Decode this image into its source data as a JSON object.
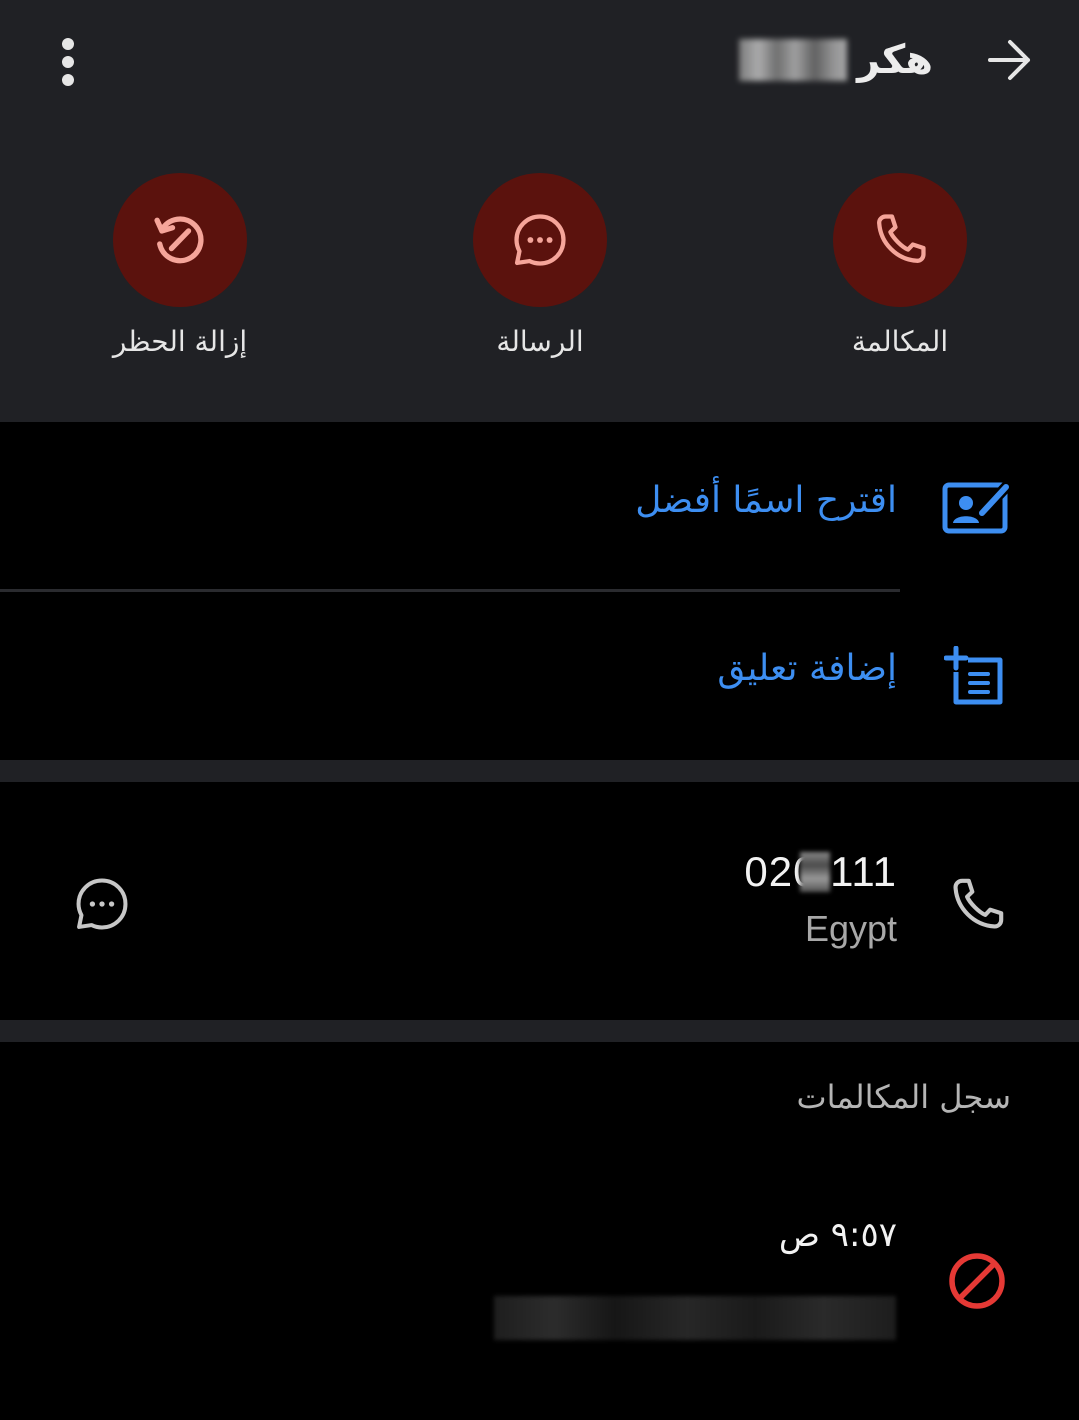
{
  "header": {
    "title": "هكر",
    "icons": {
      "back": "arrow-right-icon",
      "more": "more-vert-icon"
    }
  },
  "actions": [
    {
      "label": "المكالمة",
      "icon": "phone-icon"
    },
    {
      "label": "الرسالة",
      "icon": "message-icon"
    },
    {
      "label": "إزالة الحظر",
      "icon": "unblock-icon"
    }
  ],
  "options": {
    "suggest_name": "اقترح اسمًا أفضل",
    "add_comment": "إضافة تعليق"
  },
  "contact": {
    "number": "020  111",
    "country": "Egypt"
  },
  "call_log": {
    "title": "سجل المكالمات",
    "entries": [
      {
        "time": "٩:٥٧ ص",
        "status_icon": "blocked-icon"
      }
    ]
  },
  "colors": {
    "accent_blue": "#3d8ef1",
    "action_bg": "#5b120d",
    "action_icon": "#f5a59a",
    "blocked_red": "#e53935",
    "header_bg": "#202125"
  }
}
